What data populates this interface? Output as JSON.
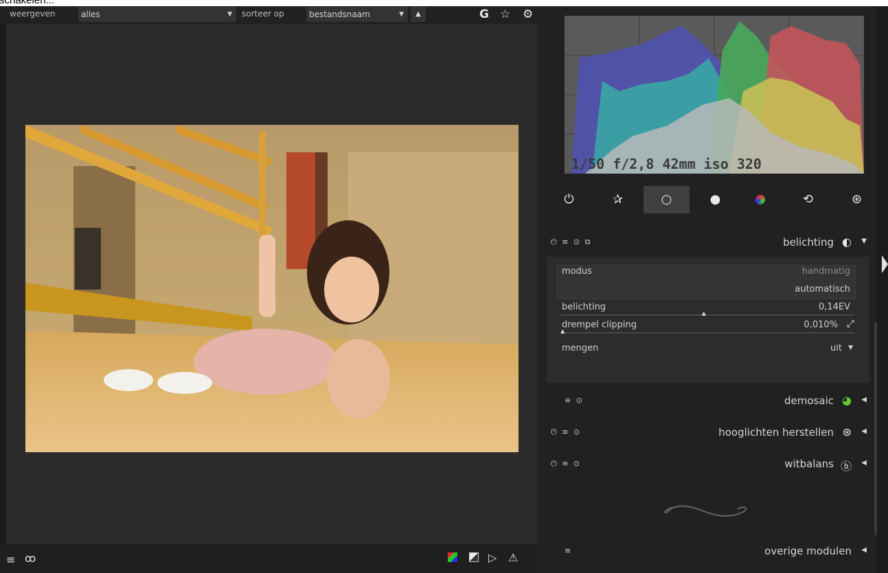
{
  "top_title_fragment": "schakelen...",
  "topbar": {
    "view_label": "weergeven",
    "view_value": "alles",
    "sort_label": "sorteer op",
    "sort_value": "bestandsnaam",
    "sort_dir_icon": "triangle-up-icon",
    "grouping_button": "G",
    "icons": [
      "grouping-icon",
      "star-icon",
      "gear-icon"
    ]
  },
  "histogram": {
    "info": "1/50 f/2,8 42mm iso 320",
    "channels": {
      "red": "#c2545a",
      "green": "#48a85a",
      "blue": "#5052b0"
    }
  },
  "module_groups": [
    "power-icon",
    "favorites-icon",
    "basic-group-icon",
    "tone-group-icon",
    "color-group-icon",
    "correct-group-icon",
    "effect-group-icon"
  ],
  "modules": {
    "belichting": {
      "name": "belichting",
      "fields": {
        "modus": {
          "label": "modus",
          "options": [
            "handmatig",
            "automatisch"
          ]
        },
        "belichting": {
          "label": "belichting",
          "value": "0,14EV",
          "level": 0.49
        },
        "drempel": {
          "label": "drempel clipping",
          "value": "0,010%",
          "level": 0.01
        },
        "mengen": {
          "label": "mengen",
          "value": "uit"
        }
      }
    },
    "demosaic": {
      "name": "demosaic"
    },
    "hooglichten": {
      "name": "hooglichten herstellen"
    },
    "witbalans": {
      "name": "witbalans"
    },
    "overige": {
      "name": "overige modulen"
    }
  },
  "bottombar": {
    "icons": [
      "menu-icon",
      "styles-icon",
      "color-assessment-icon",
      "softproof-icon",
      "gamut-check-icon",
      "warning-icon"
    ]
  }
}
